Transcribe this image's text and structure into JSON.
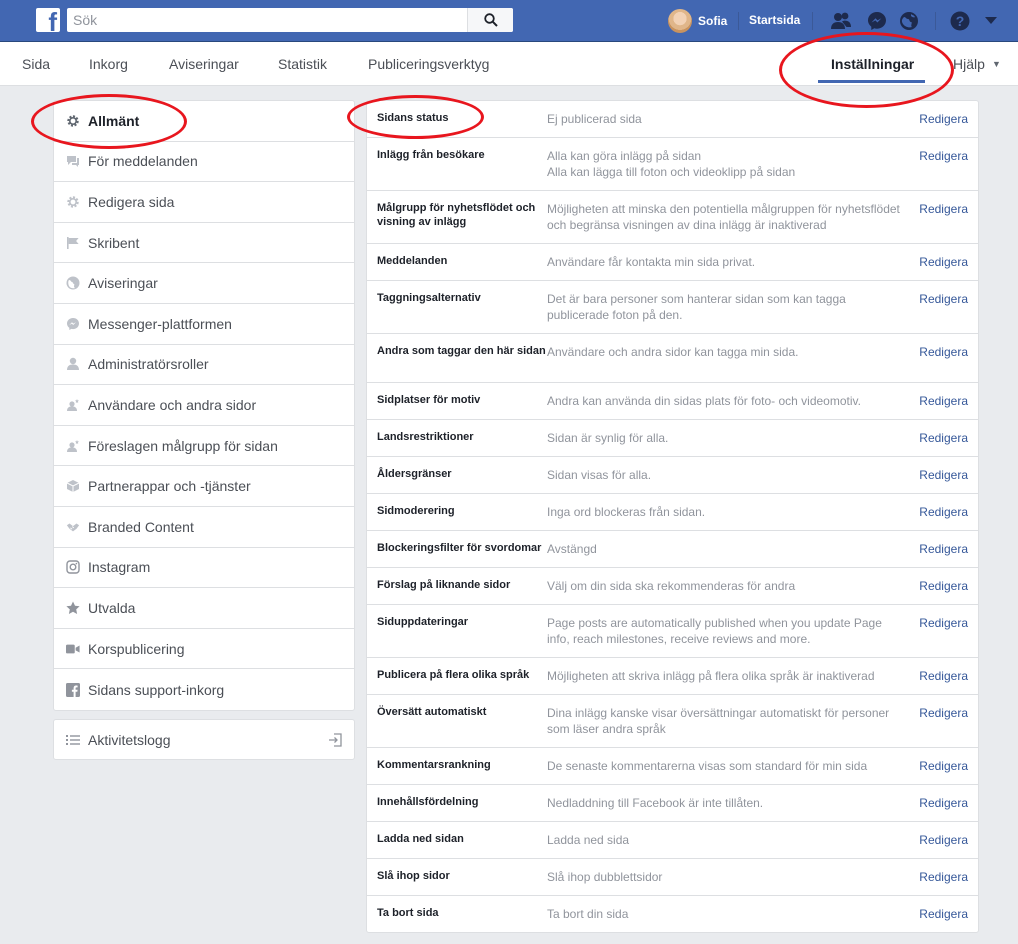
{
  "topbar": {
    "search_placeholder": "Sök",
    "profile_name": "Sofia",
    "home_label": "Startsida",
    "icons": [
      "friends-icon",
      "messenger-icon",
      "globe-icon",
      "help-icon",
      "chevron-down-icon"
    ]
  },
  "tabs": [
    {
      "label": "Sida"
    },
    {
      "label": "Inkorg"
    },
    {
      "label": "Aviseringar"
    },
    {
      "label": "Statistik"
    },
    {
      "label": "Publiceringsverktyg"
    },
    {
      "label": "Inställningar"
    },
    {
      "label": "Hjälp"
    }
  ],
  "sidebar": {
    "items": [
      {
        "label": "Allmänt",
        "icon": "gear-icon"
      },
      {
        "label": "För meddelanden",
        "icon": "chat-icon"
      },
      {
        "label": "Redigera sida",
        "icon": "gear-icon"
      },
      {
        "label": "Skribent",
        "icon": "flag-icon"
      },
      {
        "label": "Aviseringar",
        "icon": "globe-icon"
      },
      {
        "label": "Messenger-plattformen",
        "icon": "messenger-icon"
      },
      {
        "label": "Administratörsroller",
        "icon": "person-icon"
      },
      {
        "label": "Användare och andra sidor",
        "icon": "person-star-icon"
      },
      {
        "label": "Föreslagen målgrupp för sidan",
        "icon": "person-star-icon"
      },
      {
        "label": "Partnerappar och -tjänster",
        "icon": "cube-icon"
      },
      {
        "label": "Branded Content",
        "icon": "handshake-icon"
      },
      {
        "label": "Instagram",
        "icon": "instagram-icon"
      },
      {
        "label": "Utvalda",
        "icon": "star-icon"
      },
      {
        "label": "Korspublicering",
        "icon": "video-icon"
      },
      {
        "label": "Sidans support-inkorg",
        "icon": "facebook-icon"
      }
    ],
    "activity_log": "Aktivitetslogg"
  },
  "settings": {
    "edit_label": "Redigera",
    "rows": [
      {
        "label": "Sidans status",
        "value": "Ej publicerad sida"
      },
      {
        "label": "Inlägg från besökare",
        "value": "Alla kan göra inlägg på sidan\nAlla kan lägga till foton och videoklipp på sidan"
      },
      {
        "label": "Målgrupp för nyhetsflödet och visning av inlägg",
        "value": "Möjligheten att minska den potentiella målgruppen för nyhetsflödet och begränsa visningen av dina inlägg är inaktiverad"
      },
      {
        "label": "Meddelanden",
        "value": "Användare får kontakta min sida privat."
      },
      {
        "label": "Taggningsalternativ",
        "value": "Det är bara personer som hanterar sidan som kan tagga publicerade foton på den."
      },
      {
        "label": "Andra som taggar den här sidan",
        "value": "Användare och andra sidor kan tagga min sida."
      },
      {
        "label": "Sidplatser för motiv",
        "value": "Andra kan använda din sidas plats för foto- och videomotiv."
      },
      {
        "label": "Landsrestriktioner",
        "value": "Sidan är synlig för alla."
      },
      {
        "label": "Åldersgränser",
        "value": "Sidan visas för alla."
      },
      {
        "label": "Sidmoderering",
        "value": "Inga ord blockeras från sidan."
      },
      {
        "label": "Blockeringsfilter för svordomar",
        "value": "Avstängd"
      },
      {
        "label": "Förslag på liknande sidor",
        "value": "Välj om din sida ska rekommenderas för andra"
      },
      {
        "label": "Siduppdateringar",
        "value": "Page posts are automatically published when you update Page info, reach milestones, receive reviews and more."
      },
      {
        "label": "Publicera på flera olika språk",
        "value": "Möjligheten att skriva inlägg på flera olika språk är inaktiverad"
      },
      {
        "label": "Översätt automatiskt",
        "value": "Dina inlägg kanske visar översättningar automatiskt för personer som läser andra språk"
      },
      {
        "label": "Kommentarsrankning",
        "value": "De senaste kommentarerna visas som standard för min sida"
      },
      {
        "label": "Innehållsfördelning",
        "value": "Nedladdning till Facebook är inte tillåten."
      },
      {
        "label": "Ladda ned sidan",
        "value": "Ladda ned sida"
      },
      {
        "label": "Slå ihop sidor",
        "value": "Slå ihop dubblettsidor"
      },
      {
        "label": "Ta bort sida",
        "value": "Ta bort din sida"
      }
    ]
  },
  "colors": {
    "brand": "#4267b2",
    "link": "#365899",
    "annotation": "#e8161e"
  }
}
